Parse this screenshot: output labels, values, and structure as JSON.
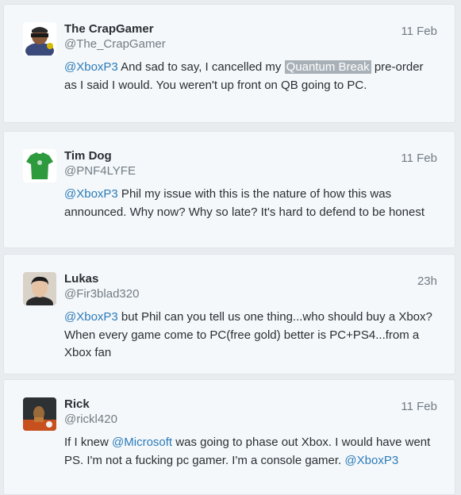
{
  "tweets": [
    {
      "name": "The CrapGamer",
      "handle": "@The_CrapGamer",
      "time": "11 Feb",
      "avatar_icon": "masked-gamer-avatar",
      "mention": "@XboxP3",
      "text_before": " And sad to say, I cancelled my ",
      "highlight": "Quantum Break",
      "text_after": " pre-order as I said I would. You weren't up front on QB going to PC."
    },
    {
      "name": "Tim Dog",
      "handle": "@PNF4LYFE",
      "time": "11 Feb",
      "avatar_icon": "green-shirt-avatar",
      "mention": "@XboxP3",
      "text": " Phil my issue with this is the nature of how this was announced. Why now? Why so late? It's hard to defend to be honest"
    },
    {
      "name": "Lukas",
      "handle": "@Fir3blad320",
      "time": "23h",
      "avatar_icon": "portrait-avatar",
      "mention": "@XboxP3",
      "text": " but Phil can you tell us one thing...who should buy a Xbox? When every game come to PC(free gold) better is PC+PS4...from a Xbox fan"
    },
    {
      "name": "Rick",
      "handle": "@rickl420",
      "time": "11 Feb",
      "avatar_icon": "game-art-avatar",
      "text_before": "If I knew ",
      "mention1": "@Microsoft",
      "text_after": " was going to phase out Xbox. I would have went PS. I'm not a fucking pc gamer. I'm a console gamer. ",
      "mention2": "@XboxP3"
    }
  ]
}
